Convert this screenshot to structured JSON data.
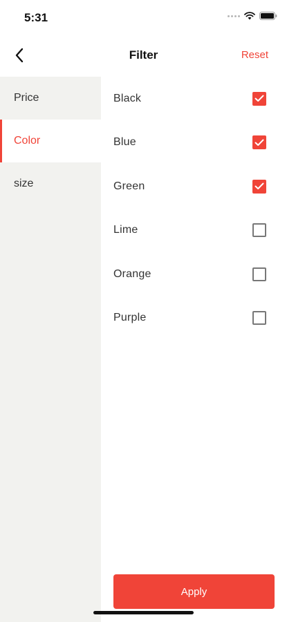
{
  "status_bar": {
    "time": "5:31"
  },
  "nav": {
    "title": "Filter",
    "reset_label": "Reset"
  },
  "sidebar": {
    "items": [
      {
        "label": "Price",
        "active": false
      },
      {
        "label": "Color",
        "active": true
      },
      {
        "label": "size",
        "active": false
      }
    ]
  },
  "options": [
    {
      "label": "Black",
      "checked": true
    },
    {
      "label": "Blue",
      "checked": true
    },
    {
      "label": "Green",
      "checked": true
    },
    {
      "label": "Lime",
      "checked": false
    },
    {
      "label": "Orange",
      "checked": false
    },
    {
      "label": "Purple",
      "checked": false
    }
  ],
  "apply_label": "Apply",
  "colors": {
    "accent": "#f04438",
    "sidebar_bg": "#f2f2ef"
  },
  "icons": {
    "back": "chevron-left-icon",
    "wifi": "wifi-icon",
    "battery": "battery-icon",
    "check": "check-icon"
  }
}
